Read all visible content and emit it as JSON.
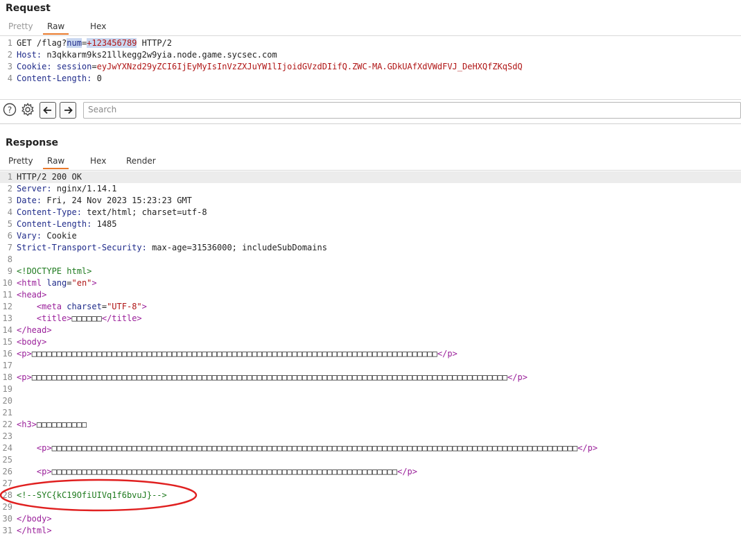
{
  "request": {
    "title": "Request",
    "tabs": [
      "Pretty",
      "Raw",
      "Hex"
    ],
    "lines": [
      {
        "n": "1",
        "parts": [
          {
            "c": "p",
            "t": "GET /flag?"
          },
          {
            "c": "k sel",
            "t": "num"
          },
          {
            "c": "p",
            "t": "="
          },
          {
            "c": "v sel",
            "t": "+123456789"
          },
          {
            "c": "p",
            "t": " HTTP/2"
          }
        ]
      },
      {
        "n": "2",
        "parts": [
          {
            "c": "k",
            "t": "Host: "
          },
          {
            "c": "p",
            "t": "n3qkkarm9ks21llkegg2w9yia.node.game.sycsec.com"
          }
        ]
      },
      {
        "n": "3",
        "parts": [
          {
            "c": "k",
            "t": "Cookie: "
          },
          {
            "c": "k",
            "t": "session"
          },
          {
            "c": "p",
            "t": "="
          },
          {
            "c": "v",
            "t": "eyJwYXNzd29yZCI6IjEyMyIsInVzZXJuYW1lIjoidGVzdDIifQ.ZWC-MA.GDkUAfXdVWdFVJ_DeHXQfZKqSdQ"
          }
        ]
      },
      {
        "n": "4",
        "parts": [
          {
            "c": "k",
            "t": "Content-Length: "
          },
          {
            "c": "p",
            "t": "0"
          }
        ]
      }
    ]
  },
  "toolbar": {
    "search_placeholder": "Search",
    "help_icon": "help-circle-icon",
    "settings_icon": "gear-icon",
    "back_icon": "arrow-left-icon",
    "forward_icon": "arrow-right-icon"
  },
  "response": {
    "title": "Response",
    "tabs": [
      "Pretty",
      "Raw",
      "Hex",
      "Render"
    ],
    "lines": [
      {
        "n": "1",
        "parts": [
          {
            "c": "p",
            "t": "HTTP/2 200 OK"
          }
        ]
      },
      {
        "n": "2",
        "parts": [
          {
            "c": "k",
            "t": "Server: "
          },
          {
            "c": "p",
            "t": "nginx/1.14.1"
          }
        ]
      },
      {
        "n": "3",
        "parts": [
          {
            "c": "k",
            "t": "Date: "
          },
          {
            "c": "p",
            "t": "Fri, 24 Nov 2023 15:23:23 GMT"
          }
        ]
      },
      {
        "n": "4",
        "parts": [
          {
            "c": "k",
            "t": "Content-Type: "
          },
          {
            "c": "p",
            "t": "text/html; charset=utf-8"
          }
        ]
      },
      {
        "n": "5",
        "parts": [
          {
            "c": "k",
            "t": "Content-Length: "
          },
          {
            "c": "p",
            "t": "1485"
          }
        ]
      },
      {
        "n": "6",
        "parts": [
          {
            "c": "k",
            "t": "Vary: "
          },
          {
            "c": "p",
            "t": "Cookie"
          }
        ]
      },
      {
        "n": "7",
        "parts": [
          {
            "c": "k",
            "t": "Strict-Transport-Security: "
          },
          {
            "c": "p",
            "t": "max-age=31536000; includeSubDomains"
          }
        ]
      },
      {
        "n": "8",
        "parts": []
      },
      {
        "n": "9",
        "parts": [
          {
            "c": "dt",
            "t": "<!DOCTYPE html>"
          }
        ]
      },
      {
        "n": "10",
        "parts": [
          {
            "c": "t",
            "t": "<html "
          },
          {
            "c": "an",
            "t": "lang"
          },
          {
            "c": "p",
            "t": "="
          },
          {
            "c": "av",
            "t": "\"en\""
          },
          {
            "c": "t",
            "t": ">"
          }
        ]
      },
      {
        "n": "11",
        "parts": [
          {
            "c": "t",
            "t": "<head>"
          }
        ]
      },
      {
        "n": "12",
        "parts": [
          {
            "c": "p",
            "t": "    "
          },
          {
            "c": "t",
            "t": "<meta "
          },
          {
            "c": "an",
            "t": "charset"
          },
          {
            "c": "p",
            "t": "="
          },
          {
            "c": "av",
            "t": "\"UTF-8\""
          },
          {
            "c": "t",
            "t": ">"
          }
        ]
      },
      {
        "n": "13",
        "parts": [
          {
            "c": "p",
            "t": "    "
          },
          {
            "c": "t",
            "t": "<title>"
          },
          {
            "c": "p",
            "t": "□□□□□□"
          },
          {
            "c": "t",
            "t": "</title>"
          }
        ]
      },
      {
        "n": "14",
        "parts": [
          {
            "c": "t",
            "t": "</head>"
          }
        ]
      },
      {
        "n": "15",
        "parts": [
          {
            "c": "t",
            "t": "<body>"
          }
        ]
      },
      {
        "n": "16",
        "parts": [
          {
            "c": "t",
            "t": "<p>"
          },
          {
            "c": "p",
            "t": "□□□□□□□□□□□□□□□□□□□□□□□□□□□□□□□□□□□□□□□□□□□□□□□□□□□□□□□□□□□□□□□□□□□□□□□□□□□□□□□□□"
          },
          {
            "c": "t",
            "t": "</p>"
          }
        ]
      },
      {
        "n": "17",
        "parts": []
      },
      {
        "n": "18",
        "parts": [
          {
            "c": "t",
            "t": "<p>"
          },
          {
            "c": "p",
            "t": "□□□□□□□□□□□□□□□□□□□□□□□□□□□□□□□□□□□□□□□□□□□□□□□□□□□□□□□□□□□□□□□□□□□□□□□□□□□□□□□□□□□□□□□□□□□□□□□"
          },
          {
            "c": "t",
            "t": "</p>"
          }
        ]
      },
      {
        "n": "19",
        "parts": []
      },
      {
        "n": "20",
        "parts": []
      },
      {
        "n": "21",
        "parts": []
      },
      {
        "n": "22",
        "parts": [
          {
            "c": "t",
            "t": "<h3>"
          },
          {
            "c": "p",
            "t": "□□□□□□□□□□"
          }
        ]
      },
      {
        "n": "23",
        "parts": []
      },
      {
        "n": "24",
        "parts": [
          {
            "c": "p",
            "t": "    "
          },
          {
            "c": "t",
            "t": "<p>"
          },
          {
            "c": "p",
            "t": "□□□□□□□□□□□□□□□□□□□□□□□□□□□□□□□□□□□□□□□□□□□□□□□□□□□□□□□□□□□□□□□□□□□□□□□□□□□□□□□□□□□□□□□□□□□□□□□□□□□□□□□□□"
          },
          {
            "c": "t",
            "t": "</p>"
          }
        ]
      },
      {
        "n": "25",
        "parts": []
      },
      {
        "n": "26",
        "parts": [
          {
            "c": "p",
            "t": "    "
          },
          {
            "c": "t",
            "t": "<p>"
          },
          {
            "c": "p",
            "t": "□□□□□□□□□□□□□□□□□□□□□□□□□□□□□□□□□□□□□□□□□□□□□□□□□□□□□□□□□□□□□□□□□□□□□"
          },
          {
            "c": "t",
            "t": "</p>"
          }
        ]
      },
      {
        "n": "27",
        "parts": []
      },
      {
        "n": "28",
        "parts": [
          {
            "c": "cm",
            "t": "<!--SYC{kC19OfiUIVq1f6bvuJ}-->"
          }
        ]
      },
      {
        "n": "29",
        "parts": []
      },
      {
        "n": "30",
        "parts": [
          {
            "c": "t",
            "t": "</body>"
          }
        ]
      },
      {
        "n": "31",
        "parts": [
          {
            "c": "t",
            "t": "</html>"
          }
        ]
      }
    ]
  },
  "annotation": {
    "color": "#e02020"
  }
}
